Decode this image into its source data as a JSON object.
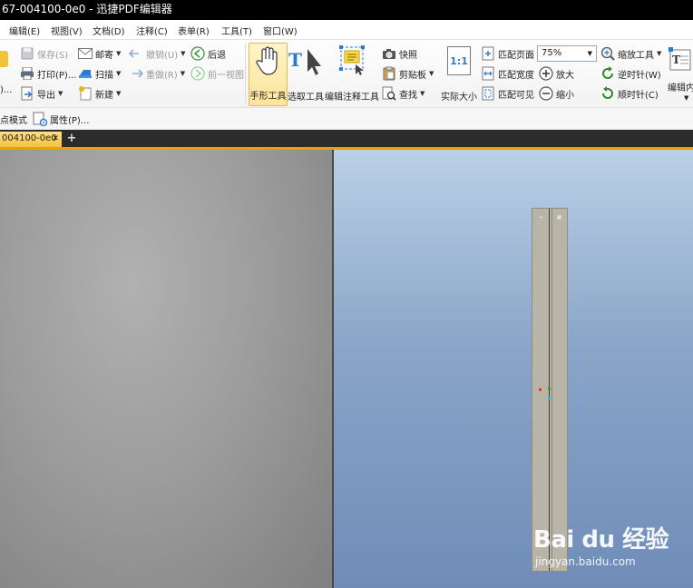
{
  "window": {
    "title": "67-004100-0e0 - 迅捷PDF编辑器"
  },
  "menu": [
    "编辑(E)",
    "视图(V)",
    "文档(D)",
    "注释(C)",
    "表单(R)",
    "工具(T)",
    "窗口(W)"
  ],
  "ribbon": {
    "save": "保存(S)",
    "print": "打印(P)...",
    "export": "导出",
    "email": "邮寄",
    "scan": "扫描",
    "new": "新建",
    "undo": "撤销(U)",
    "redo": "重做(R)",
    "back": "后退",
    "forward": "前一视图",
    "hand_tool": "手形工具",
    "select_tool": "选取工具",
    "annotate_tool": "编辑注释工具",
    "snapshot": "快照",
    "clipboard": "剪贴板",
    "find": "查找",
    "actual_size": "实际大小",
    "actual_size_icon_text": "1:1",
    "fit_page": "匹配页面",
    "fit_width": "匹配宽度",
    "fit_visible": "匹配可见",
    "zoom_value": "75%",
    "zoom_in": "放大",
    "zoom_out": "缩小",
    "zoom_tool": "缩放工具",
    "rotate_ccw": "逆时针(W)",
    "rotate_cw": "顺时针(C)",
    "edit_content": "编辑内"
  },
  "quickbar": {
    "mode": "点模式",
    "properties": "属性(P)..."
  },
  "tabs": [
    {
      "label": "004100-0e0"
    }
  ],
  "watermark": {
    "logo": "Bai du 经验",
    "url": "jingyan.baidu.com"
  }
}
